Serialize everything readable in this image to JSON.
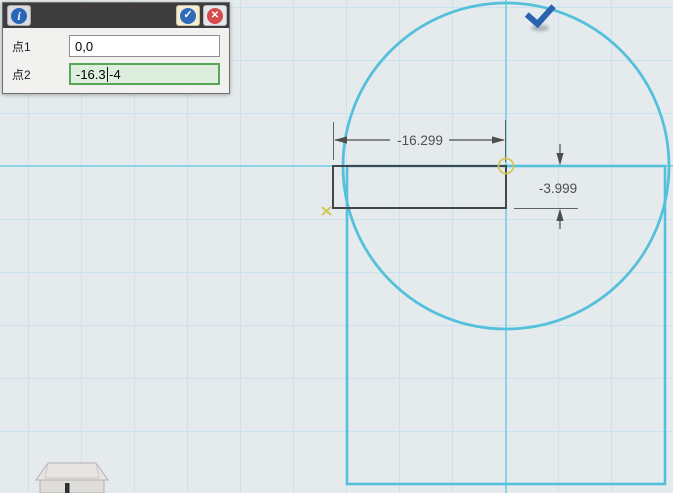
{
  "dialog": {
    "info_icon_glyph": "i",
    "confirm_icon_glyph": "✓",
    "close_icon_glyph": "✕",
    "fields": [
      {
        "label": "点1",
        "value": "0,0"
      },
      {
        "label": "点2",
        "value_before_caret": "-16.3",
        "value_after_caret": "-4"
      }
    ]
  },
  "canvas": {
    "dimensions": {
      "horizontal_label": "-16.299",
      "vertical_label": "-3.999"
    },
    "colors": {
      "background": "#e5ebed",
      "grid": "#cbe3ee",
      "axis": "#84cfe4",
      "sketch_stroke": "#55c0db",
      "profile_stroke": "#43474a",
      "dimension": "#4e4e4e",
      "marker_yellow": "#d2c750",
      "check_badge_blue": "#2a63b0",
      "active_input_bg": "#deeede",
      "active_input_border": "#58a758"
    }
  }
}
